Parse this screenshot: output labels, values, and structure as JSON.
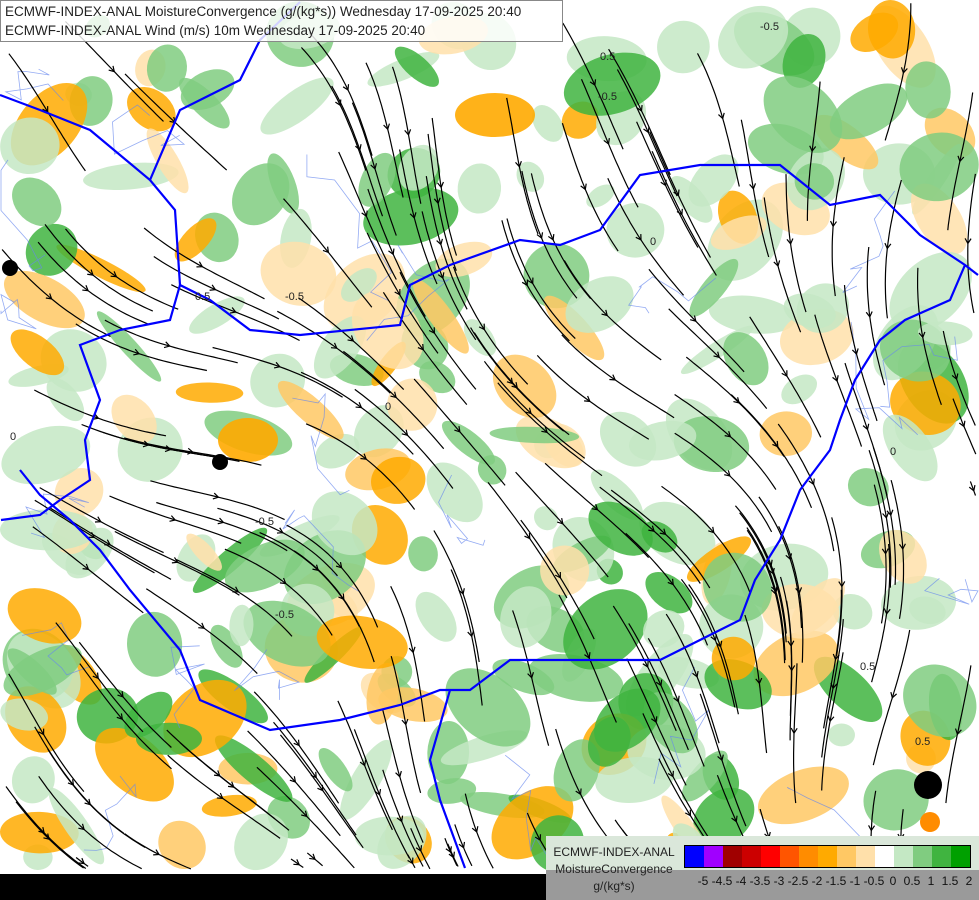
{
  "title": {
    "line1": "ECMWF-INDEX-ANAL MoistureConvergence (g/(kg*s)) Wednesday 17-09-2025 20:40",
    "line2": "ECMWF-INDEX-ANAL Wind (m/s) 10m Wednesday 17-09-2025 20:40"
  },
  "legend": {
    "model": "ECMWF-INDEX-ANAL",
    "variable": "MoistureConvergence",
    "units": "g/(kg*s)",
    "colors": [
      "#0000ff",
      "#a000ff",
      "#a00000",
      "#cc0000",
      "#ff0000",
      "#ff5500",
      "#ff8c00",
      "#ffaa00",
      "#ffc864",
      "#ffe0aa",
      "#ffffff",
      "#c4e8c4",
      "#80cc80",
      "#40b440",
      "#00a000"
    ],
    "ticks": [
      "-5",
      "-4.5",
      "-4",
      "-3.5",
      "-3",
      "-2.5",
      "-2",
      "-1.5",
      "-1",
      "-0.5",
      "0",
      "0.5",
      "1",
      "1.5",
      "2"
    ]
  },
  "map": {
    "border_color": "#0000ff",
    "river_color": "#6688ee",
    "streamline_color": "#000000",
    "contour_labels": [
      "0",
      "0.5",
      "-0.5"
    ]
  }
}
